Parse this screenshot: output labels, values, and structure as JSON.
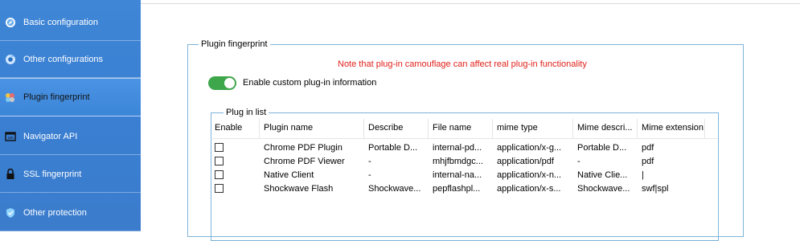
{
  "sidebar": {
    "items": [
      {
        "label": "Basic configuration",
        "icon": "compass-icon"
      },
      {
        "label": "Other configurations",
        "icon": "chrome-icon"
      },
      {
        "label": "Plugin fingerprint",
        "icon": "puzzle-icon",
        "active": true
      },
      {
        "label": "Navigator API",
        "icon": "api-icon"
      },
      {
        "label": "SSL fingerprint",
        "icon": "lock-icon"
      },
      {
        "label": "Other protection",
        "icon": "shield-icon"
      }
    ]
  },
  "plugin_group": {
    "title": "Plugin fingerprint",
    "warning": "Note that plug-in camouflage can affect real plug-in functionality",
    "toggle_label": "Enable custom plug-in information",
    "toggle_on": true
  },
  "plugin_list": {
    "title": "Plug in list",
    "columns": [
      "Enable",
      "Plugin name",
      "Describe",
      "File name",
      "mime type",
      "Mime descri...",
      "Mime extension"
    ],
    "rows": [
      [
        "",
        "Chrome PDF Plugin",
        "Portable D...",
        "internal-pd...",
        "application/x-g...",
        "Portable D...",
        "pdf"
      ],
      [
        "",
        "Chrome PDF Viewer",
        "-",
        "mhjfbmdgc...",
        "application/pdf",
        "-",
        "pdf"
      ],
      [
        "",
        "Native Client",
        "-",
        "internal-na...",
        "application/x-n...",
        "Native Clie...",
        "|"
      ],
      [
        "",
        "Shockwave Flash",
        "Shockwave...",
        "pepflashpl...",
        "application/x-s...",
        "Shockwave...",
        "swf|spl"
      ]
    ]
  },
  "colors": {
    "sidebar": "#3b80d2",
    "warning": "#e0201a",
    "toggle": "#3ea64b",
    "groupbox_border": "#7fb4d9"
  }
}
